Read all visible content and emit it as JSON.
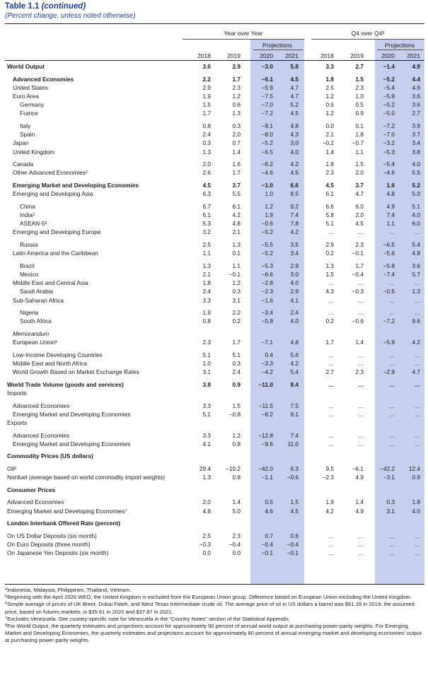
{
  "title": {
    "main": "Table 1.1 ",
    "cont": "(continued)"
  },
  "subtitle": "(Percent change, unless noted otherwise)",
  "headers": {
    "yoy": "Year over Year",
    "q4": "Q4 over Q4",
    "q4_sup": "8",
    "projections": "Projections",
    "years": [
      "2018",
      "2019",
      "2020",
      "2021",
      "2018",
      "2019",
      "2020",
      "2021"
    ]
  },
  "rows": [
    {
      "label": "World Output",
      "style": "b",
      "indent": 0,
      "values": [
        "3.6",
        "2.9",
        "−3.0",
        "5.8",
        "3.3",
        "2.7",
        "−1.4",
        "4.9"
      ]
    },
    {
      "label": "Advanced Economies",
      "style": "b",
      "indent": 1,
      "gap": true,
      "values": [
        "2.2",
        "1.7",
        "−6.1",
        "4.5",
        "1.8",
        "1.5",
        "−5.2",
        "4.4"
      ]
    },
    {
      "label": "United States",
      "indent": 1,
      "values": [
        "2.9",
        "2.3",
        "−5.9",
        "4.7",
        "2.5",
        "2.3",
        "−5.4",
        "4.9"
      ]
    },
    {
      "label": "Euro Area",
      "indent": 1,
      "values": [
        "1.9",
        "1.2",
        "−7.5",
        "4.7",
        "1.2",
        "1.0",
        "−5.9",
        "3.6"
      ]
    },
    {
      "label": "Germany",
      "indent": 2,
      "values": [
        "1.5",
        "0.6",
        "−7.0",
        "5.2",
        "0.6",
        "0.5",
        "−5.2",
        "3.6"
      ]
    },
    {
      "label": "France",
      "indent": 2,
      "values": [
        "1.7",
        "1.3",
        "−7.2",
        "4.5",
        "1.2",
        "0.9",
        "−5.0",
        "2.7"
      ]
    },
    {
      "label": "Italy",
      "indent": 2,
      "gap": true,
      "values": [
        "0.8",
        "0.3",
        "−9.1",
        "4.8",
        "0.0",
        "0.1",
        "−7.2",
        "3.9"
      ]
    },
    {
      "label": "Spain",
      "indent": 2,
      "values": [
        "2.4",
        "2.0",
        "−8.0",
        "4.3",
        "2.1",
        "1.8",
        "−7.0",
        "3.7"
      ]
    },
    {
      "label": "Japan",
      "indent": 1,
      "values": [
        "0.3",
        "0.7",
        "−5.2",
        "3.0",
        "−0.2",
        "−0.7",
        "−3.2",
        "3.4"
      ]
    },
    {
      "label": "United Kingdom",
      "indent": 1,
      "values": [
        "1.3",
        "1.4",
        "−6.5",
        "4.0",
        "1.4",
        "1.1",
        "−5.3",
        "3.8"
      ]
    },
    {
      "label": "Canada",
      "indent": 1,
      "gap": true,
      "values": [
        "2.0",
        "1.6",
        "−6.2",
        "4.2",
        "1.8",
        "1.5",
        "−5.4",
        "4.0"
      ]
    },
    {
      "label": "Other Advanced Economies",
      "sup": "2",
      "indent": 1,
      "values": [
        "2.6",
        "1.7",
        "−4.6",
        "4.5",
        "2.3",
        "2.0",
        "−4.6",
        "5.5"
      ]
    },
    {
      "label": "Emerging Market and Developing Economies",
      "style": "b",
      "indent": 1,
      "gap": true,
      "values": [
        "4.5",
        "3.7",
        "−1.0",
        "6.6",
        "4.5",
        "3.7",
        "1.6",
        "5.2"
      ]
    },
    {
      "label": "Emerging and Developing Asia",
      "indent": 1,
      "values": [
        "6.3",
        "5.5",
        "1.0",
        "8.5",
        "6.1",
        "4.7",
        "4.8",
        "5.0"
      ]
    },
    {
      "label": "China",
      "indent": 2,
      "gap": true,
      "values": [
        "6.7",
        "6.1",
        "1.2",
        "9.2",
        "6.6",
        "6.0",
        "4.9",
        "5.1"
      ]
    },
    {
      "label": "India",
      "sup": "3",
      "indent": 2,
      "values": [
        "6.1",
        "4.2",
        "1.9",
        "7.4",
        "5.8",
        "2.0",
        "7.4",
        "4.0"
      ]
    },
    {
      "label": "ASEAN-5",
      "sup": "4",
      "indent": 2,
      "values": [
        "5.3",
        "4.8",
        "−0.6",
        "7.8",
        "5.1",
        "4.5",
        "1.1",
        "6.0"
      ]
    },
    {
      "label": "Emerging and Developing Europe",
      "indent": 1,
      "values": [
        "3.2",
        "2.1",
        "−5.2",
        "4.2",
        "…",
        "…",
        "…",
        "…"
      ]
    },
    {
      "label": "Russia",
      "indent": 2,
      "gap": true,
      "values": [
        "2.5",
        "1.3",
        "−5.5",
        "3.5",
        "2.9",
        "2.3",
        "−6.5",
        "5.4"
      ]
    },
    {
      "label": "Latin America and the Caribbean",
      "indent": 1,
      "values": [
        "1.1",
        "0.1",
        "−5.2",
        "3.4",
        "0.2",
        "−0.1",
        "−5.6",
        "4.8"
      ]
    },
    {
      "label": "Brazil",
      "indent": 2,
      "gap": true,
      "values": [
        "1.3",
        "1.1",
        "−5.3",
        "2.9",
        "1.3",
        "1.7",
        "−5.8",
        "3.6"
      ]
    },
    {
      "label": "Mexico",
      "indent": 2,
      "values": [
        "2.1",
        "−0.1",
        "−6.6",
        "3.0",
        "1.5",
        "−0.4",
        "−7.4",
        "5.7"
      ]
    },
    {
      "label": "Middle East and Central Asia",
      "indent": 1,
      "values": [
        "1.8",
        "1.2",
        "−2.8",
        "4.0",
        "…",
        "…",
        "…",
        "…"
      ]
    },
    {
      "label": "Saudi Arabia",
      "indent": 2,
      "values": [
        "2.4",
        "0.3",
        "−2.3",
        "2.9",
        "4.3",
        "−0.3",
        "−0.5",
        "1.3"
      ]
    },
    {
      "label": "Sub-Saharan Africa",
      "indent": 1,
      "values": [
        "3.3",
        "3.1",
        "−1.6",
        "4.1",
        "…",
        "…",
        "…",
        "…"
      ]
    },
    {
      "label": "Nigeria",
      "indent": 2,
      "gap": true,
      "values": [
        "1.9",
        "2.2",
        "−3.4",
        "2.4",
        "…",
        "…",
        "…",
        "…"
      ]
    },
    {
      "label": "South Africa",
      "indent": 2,
      "values": [
        "0.8",
        "0.2",
        "−5.8",
        "4.0",
        "0.2",
        "−0.6",
        "−7.2",
        "9.6"
      ]
    },
    {
      "label": "Memorandum",
      "style": "it",
      "indent": 1,
      "gap": true,
      "values": [
        "",
        "",
        "",
        "",
        "",
        "",
        "",
        ""
      ]
    },
    {
      "label": "European Union",
      "sup": "5",
      "indent": 1,
      "values": [
        "2.3",
        "1.7",
        "−7.1",
        "4.8",
        "1.7",
        "1.4",
        "−5.9",
        "4.2"
      ]
    },
    {
      "label": "Low-Income Developing Countries",
      "indent": 1,
      "gap": true,
      "values": [
        "5.1",
        "5.1",
        "0.4",
        "5.6",
        "…",
        "…",
        "…",
        "…"
      ]
    },
    {
      "label": "Middle East and North Africa",
      "indent": 1,
      "values": [
        "1.0",
        "0.3",
        "−3.3",
        "4.2",
        "…",
        "…",
        "…",
        "…"
      ]
    },
    {
      "label": "World Growth Based on Market Exchange Rates",
      "indent": 1,
      "values": [
        "3.1",
        "2.4",
        "−4.2",
        "5.4",
        "2.7",
        "2.3",
        "−2.9",
        "4.7"
      ]
    },
    {
      "label": "World Trade Volume (goods and services)",
      "style": "b",
      "indent": 0,
      "gap": true,
      "values": [
        "3.8",
        "0.9",
        "−11.0",
        "8.4",
        "…",
        "…",
        "…",
        "…"
      ]
    },
    {
      "label": "Imports",
      "indent": 0,
      "values": [
        "",
        "",
        "",
        "",
        "",
        "",
        "",
        ""
      ]
    },
    {
      "label": "Advanced Economies",
      "indent": 1,
      "gap": true,
      "values": [
        "3.3",
        "1.5",
        "−11.5",
        "7.5",
        "…",
        "…",
        "…",
        "…"
      ]
    },
    {
      "label": "Emerging Market and Developing Economies",
      "indent": 1,
      "values": [
        "5.1",
        "−0.8",
        "−8.2",
        "9.1",
        "…",
        "…",
        "…",
        "…"
      ]
    },
    {
      "label": "Exports",
      "indent": 0,
      "values": [
        "",
        "",
        "",
        "",
        "",
        "",
        "",
        ""
      ]
    },
    {
      "label": "Advanced Economies",
      "indent": 1,
      "gap": true,
      "values": [
        "3.3",
        "1.2",
        "−12.8",
        "7.4",
        "…",
        "…",
        "…",
        "…"
      ]
    },
    {
      "label": "Emerging Market and Developing Economies",
      "indent": 1,
      "values": [
        "4.1",
        "0.8",
        "−9.6",
        "11.0",
        "…",
        "…",
        "…",
        "…"
      ]
    },
    {
      "label": "Commodity Prices (US dollars)",
      "style": "b",
      "indent": 0,
      "gap": true,
      "values": [
        "",
        "",
        "",
        "",
        "",
        "",
        "",
        ""
      ]
    },
    {
      "label": "Oil",
      "sup": "6",
      "indent": 0,
      "gap": true,
      "values": [
        "29.4",
        "−10.2",
        "−42.0",
        "6.3",
        "9.5",
        "−6.1",
        "−42.2",
        "12.4"
      ]
    },
    {
      "label": "Nonfuel (average based on world commodity import weights)",
      "indent": 0,
      "values": [
        "1.3",
        "0.8",
        "−1.1",
        "−0.6",
        "−2.3",
        "4.9",
        "−3.1",
        "0.9"
      ]
    },
    {
      "label": "Consumer Prices",
      "style": "b",
      "indent": 0,
      "gap": true,
      "values": [
        "",
        "",
        "",
        "",
        "",
        "",
        "",
        ""
      ]
    },
    {
      "label": "Advanced Economies",
      "indent": 0,
      "gap": true,
      "values": [
        "2.0",
        "1.4",
        "0.5",
        "1.5",
        "1.9",
        "1.4",
        "0.3",
        "1.8"
      ]
    },
    {
      "label": "Emerging Market and Developing Economies",
      "sup": "7",
      "indent": 0,
      "values": [
        "4.8",
        "5.0",
        "4.6",
        "4.5",
        "4.2",
        "4.9",
        "3.1",
        "4.0"
      ]
    },
    {
      "label": "London Interbank Offered Rate (percent)",
      "style": "b",
      "indent": 0,
      "gap": true,
      "values": [
        "",
        "",
        "",
        "",
        "",
        "",
        "",
        ""
      ]
    },
    {
      "label": "On US Dollar Deposits (six month)",
      "indent": 0,
      "gap": true,
      "values": [
        "2.5",
        "2.3",
        "0.7",
        "0.6",
        "…",
        "…",
        "…",
        "…"
      ]
    },
    {
      "label": "On Euro Deposits (three month)",
      "indent": 0,
      "values": [
        "−0.3",
        "−0.4",
        "−0.4",
        "−0.4",
        "…",
        "…",
        "…",
        "…"
      ]
    },
    {
      "label": "On Japanese Yen Deposits (six month)",
      "indent": 0,
      "values": [
        "0.0",
        "0.0",
        "−0.1",
        "−0.1",
        "…",
        "…",
        "…",
        "…"
      ]
    }
  ],
  "footnotes": [
    {
      "sup": "4",
      "text": "Indonesia, Malaysia, Philippines, Thailand, Vietnam."
    },
    {
      "sup": "5",
      "text": "Beginning with the April 2020 WEO, the United Kingdom is excluded from the European Union group. Difference based on European Union excluding the United Kingdom."
    },
    {
      "sup": "6",
      "text": "Simple average of prices of UK Brent, Dubai Fateh, and West Texas Intermediate crude oil. The average price of oil in US dollars a barrel was $61.39 in 2019; the assumed price, based on futures markets, is $35.61 in 2020 and $37.87 in 2021."
    },
    {
      "sup": "7",
      "text": "Excludes Venezuela. See country-specific note for Venezuela in the “Country Notes” section of the Statistical Appendix."
    },
    {
      "sup": "8",
      "text": "For World Output, the quarterly estimates and projections account for approximately 90 percent of annual world output at purchasing-power-parity weights. For Emerging Market and Developing Economies, the quarterly estimates and projections account for approximately 80 percent of annual emerging market and developing economies’ output at purchasing-power-parity weights."
    }
  ]
}
